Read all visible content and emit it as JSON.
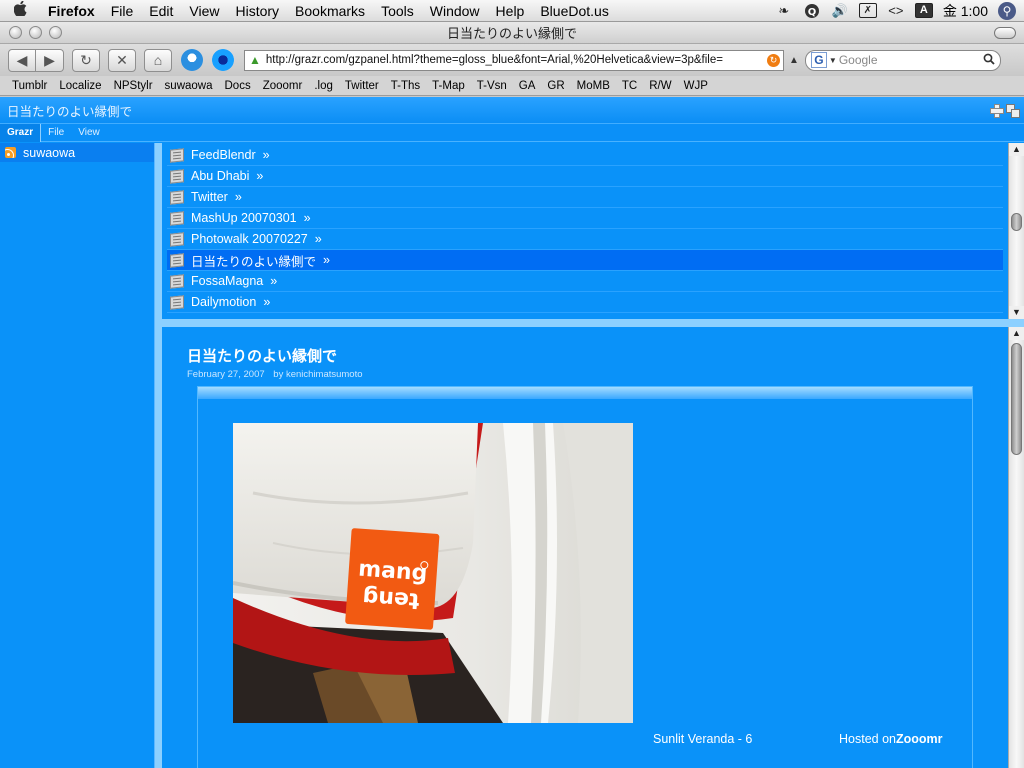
{
  "menubar": {
    "apple": "",
    "items": [
      "Firefox",
      "File",
      "Edit",
      "View",
      "History",
      "Bookmarks",
      "Tools",
      "Window",
      "Help",
      "BlueDot.us"
    ],
    "tray": {
      "input_method": "A",
      "clock": "金 1:00"
    }
  },
  "window": {
    "title": "日当たりのよい縁側で"
  },
  "toolbar": {
    "url": "http://grazr.com/gzpanel.html?theme=gloss_blue&font=Arial,%20Helvetica&view=3p&file=",
    "search_placeholder": "Google",
    "search_engine_letter": "G"
  },
  "bookmarks": [
    "Tumblr",
    "Localize",
    "NPStylr",
    "suwaowa",
    "Docs",
    "Zooomr",
    ".log",
    "Twitter",
    "T-Ths",
    "T-Map",
    "T-Vsn",
    "GA",
    "GR",
    "MoMB",
    "TC",
    "R/W",
    "WJP"
  ],
  "grazr": {
    "header_title": "日当たりのよい縁側で",
    "tabs": [
      "Grazr",
      "File",
      "View"
    ],
    "feeds": [
      {
        "label": "suwaowa"
      }
    ],
    "items": [
      {
        "label": "FeedBlendr",
        "arrow": "»",
        "selected": false
      },
      {
        "label": "Abu Dhabi",
        "arrow": "»",
        "selected": false
      },
      {
        "label": "Twitter",
        "arrow": "»",
        "selected": false
      },
      {
        "label": "MashUp 20070301",
        "arrow": "»",
        "selected": false
      },
      {
        "label": "Photowalk 20070227",
        "arrow": "»",
        "selected": false
      },
      {
        "label": "日当たりのよい縁側で",
        "arrow": "»",
        "selected": true
      },
      {
        "label": "FossaMagna",
        "arrow": "»",
        "selected": false
      },
      {
        "label": "Dailymotion",
        "arrow": "»",
        "selected": false
      }
    ],
    "post": {
      "title": "日当たりのよい縁側で",
      "date": "February 27, 2007",
      "author": "by kenichimatsumoto",
      "tag_text_line1": "mang",
      "tag_text_line2": "teng",
      "caption": "Sunlit Veranda - 6",
      "hosted_prefix": "Hosted on",
      "hosted_brand": "Zooomr"
    }
  },
  "colors": {
    "grazr_bg": "#0a92f9",
    "selected_item": "#006df3",
    "splitter": "#8cd0ff",
    "tag_orange": "#f25a12"
  }
}
